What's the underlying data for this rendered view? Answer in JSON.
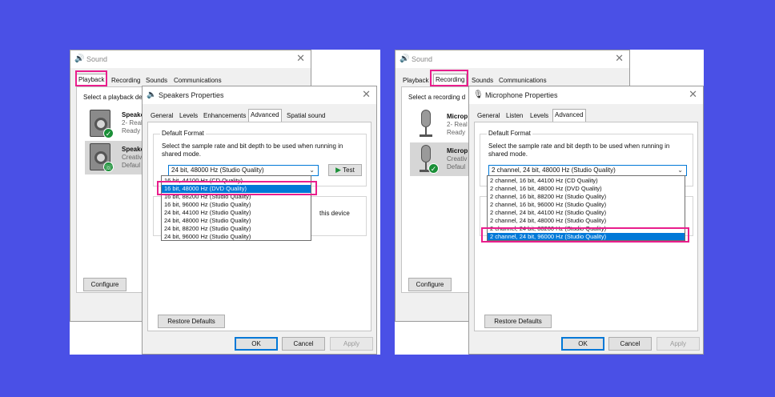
{
  "colors": {
    "background": "#4a50e6",
    "highlight": "#e91e8c",
    "selection": "#0078d7",
    "status_check": "#1a8f37"
  },
  "left": {
    "sound": {
      "title": "Sound",
      "close": "✕",
      "tabs": [
        "Playback",
        "Recording",
        "Sounds",
        "Communications"
      ],
      "active_tab": "Playback",
      "select_text": "Select a playback de",
      "devices": [
        {
          "name": "Speake",
          "line2": "2- Real",
          "line3": "Ready",
          "icon": "speaker-icon",
          "status": "check"
        },
        {
          "name": "Speake",
          "line2": "Creativ",
          "line3": "Defaul",
          "icon": "speaker-icon",
          "status": "phone"
        }
      ],
      "configure_label": "Configure"
    },
    "props": {
      "title": "Speakers Properties",
      "close": "✕",
      "tabs": [
        "General",
        "Levels",
        "Enhancements",
        "Advanced",
        "Spatial sound"
      ],
      "active_tab": "Advanced",
      "group_label": "Default Format",
      "description": "Select the sample rate and bit depth to be used when running in shared mode.",
      "selected_value": "24 bit, 48000 Hz (Studio Quality)",
      "test_label": "Test",
      "options": [
        "16 bit, 44100 Hz (CD Quality)",
        "16 bit, 48000 Hz (DVD Quality)",
        "16 bit, 88200 Hz (Studio Quality)",
        "16 bit, 96000 Hz (Studio Quality)",
        "24 bit, 44100 Hz (Studio Quality)",
        "24 bit, 48000 Hz (Studio Quality)",
        "24 bit, 88200 Hz (Studio Quality)",
        "24 bit, 96000 Hz (Studio Quality)"
      ],
      "highlighted_option": "16 bit, 48000 Hz (DVD Quality)",
      "exclusive_partial": "this device",
      "restore_label": "Restore Defaults",
      "ok_label": "OK",
      "cancel_label": "Cancel",
      "apply_label": "Apply"
    }
  },
  "right": {
    "sound": {
      "title": "Sound",
      "close": "✕",
      "tabs": [
        "Playback",
        "Recording",
        "Sounds",
        "Communications"
      ],
      "active_tab": "Recording",
      "select_text": "Select a recording d",
      "devices": [
        {
          "name": "Microp",
          "line2": "2- Real",
          "line3": "Ready",
          "icon": "microphone-icon",
          "status": "none"
        },
        {
          "name": "Microp",
          "line2": "Creativ",
          "line3": "Defaul",
          "icon": "microphone-icon",
          "status": "check"
        }
      ],
      "configure_label": "Configure"
    },
    "props": {
      "title": "Microphone Properties",
      "close": "✕",
      "tabs": [
        "General",
        "Listen",
        "Levels",
        "Advanced"
      ],
      "active_tab": "Advanced",
      "group_label": "Default Format",
      "description": "Select the sample rate and bit depth to be used when running in shared mode.",
      "selected_value": "2 channel, 24 bit, 48000 Hz (Studio Quality)",
      "options": [
        "2 channel, 16 bit, 44100 Hz (CD Quality)",
        "2 channel, 16 bit, 48000 Hz (DVD Quality)",
        "2 channel, 16 bit, 88200 Hz (Studio Quality)",
        "2 channel, 16 bit, 96000 Hz (Studio Quality)",
        "2 channel, 24 bit, 44100 Hz (Studio Quality)",
        "2 channel, 24 bit, 48000 Hz (Studio Quality)",
        "2 channel, 24 bit, 88200 Hz (Studio Quality)",
        "2 channel, 24 bit, 96000 Hz (Studio Quality)"
      ],
      "highlighted_option": "2 channel, 24 bit, 96000 Hz (Studio Quality)",
      "restore_label": "Restore Defaults",
      "ok_label": "OK",
      "cancel_label": "Cancel",
      "apply_label": "Apply"
    }
  }
}
